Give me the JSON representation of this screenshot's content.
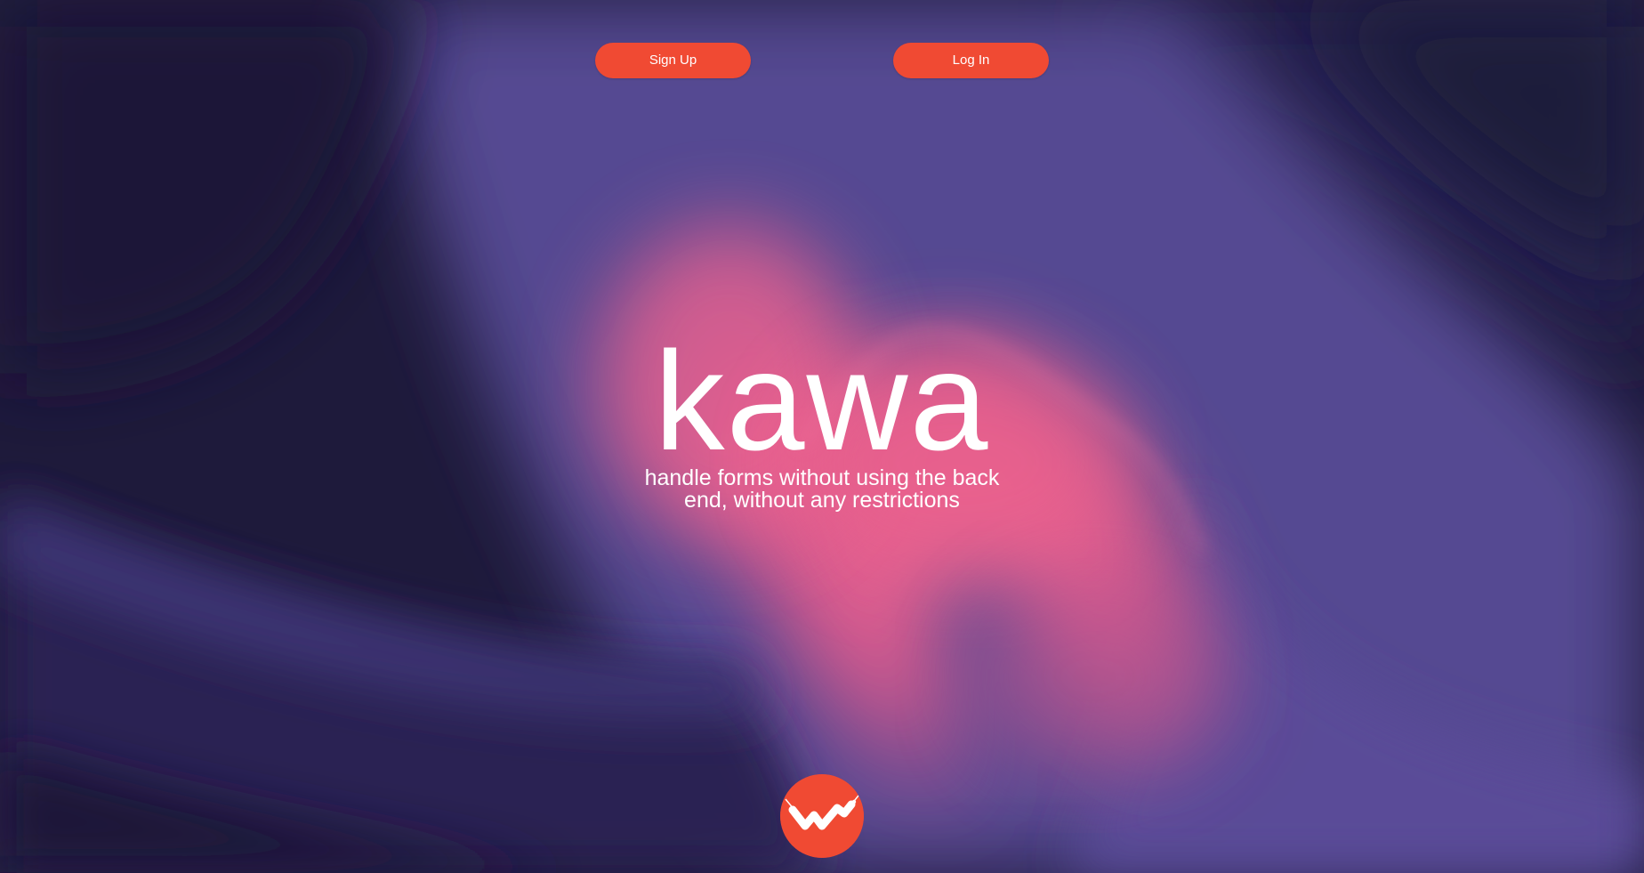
{
  "nav": {
    "signup_label": "Sign Up",
    "login_label": "Log In"
  },
  "hero": {
    "title": "kawa",
    "subtitle_line1": "handle forms without using the back",
    "subtitle_line2": "end, without any restrictions"
  },
  "logo": {
    "icon": "kawa-w-logo-icon"
  },
  "colors": {
    "accent": "#f04a33",
    "background_dark": "#1f1a3d",
    "purple": "#574b94",
    "pink": "#f0628e",
    "text": "#ffffff"
  }
}
